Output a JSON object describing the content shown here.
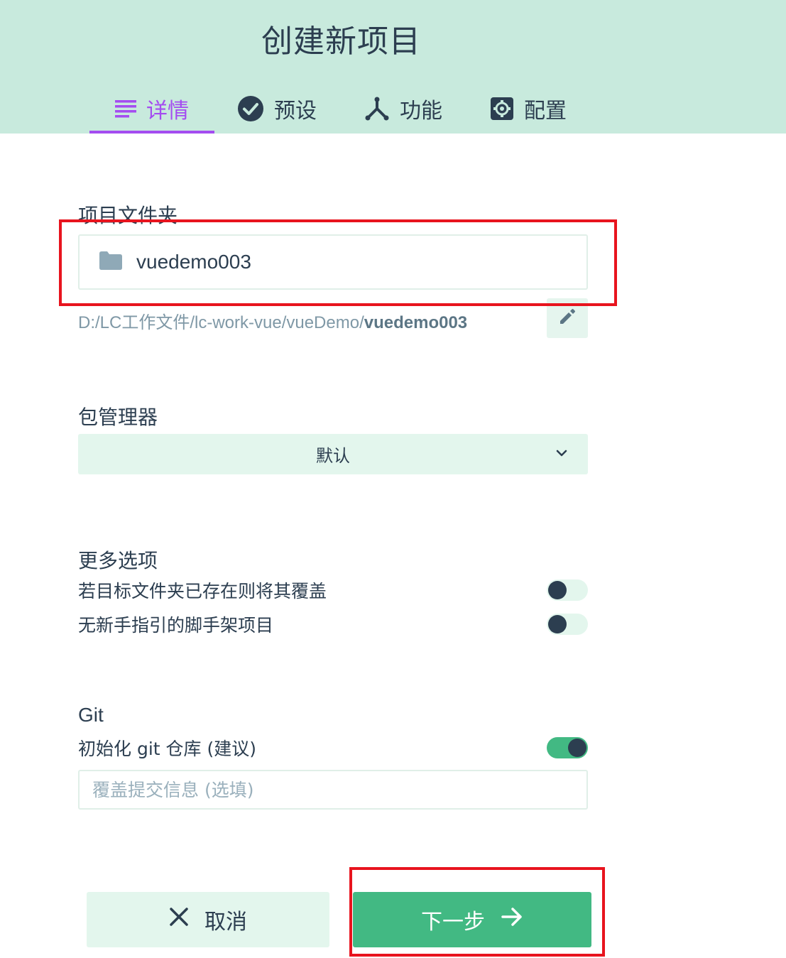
{
  "header": {
    "title": "创建新项目",
    "tabs": [
      {
        "label": "详情",
        "icon": "list-icon",
        "active": true
      },
      {
        "label": "预设",
        "icon": "check-circle-icon",
        "active": false
      },
      {
        "label": "功能",
        "icon": "fork-icon",
        "active": false
      },
      {
        "label": "配置",
        "icon": "gear-icon",
        "active": false
      }
    ]
  },
  "folder": {
    "label": "项目文件夹",
    "value": "vuedemo003",
    "path_prefix": "D:/LC工作文件/lc-work-vue/vueDemo/",
    "path_name": "vuedemo003",
    "edit_icon": "pencil-icon"
  },
  "package_manager": {
    "label": "包管理器",
    "value": "默认"
  },
  "more_options": {
    "label": "更多选项",
    "items": [
      {
        "label": "若目标文件夹已存在则将其覆盖",
        "enabled": false
      },
      {
        "label": "无新手指引的脚手架项目",
        "enabled": false
      }
    ]
  },
  "git": {
    "label": "Git",
    "init_label": "初始化 git 仓库 (建议)",
    "init_enabled": true,
    "commit_placeholder": "覆盖提交信息 (选填)",
    "commit_value": ""
  },
  "actions": {
    "cancel_label": "取消",
    "next_label": "下一步"
  },
  "colors": {
    "header_bg": "#c8eadd",
    "active_tab": "#a44cf0",
    "primary": "#42b983",
    "light_green": "#e3f6ed",
    "text": "#2c3e50",
    "annotation": "#e8141e"
  }
}
